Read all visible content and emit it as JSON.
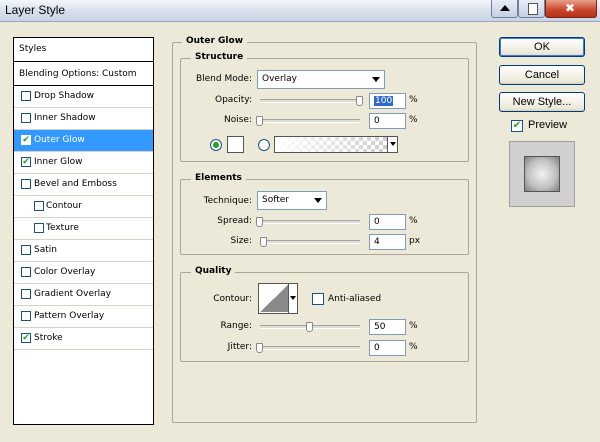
{
  "window": {
    "title": "Layer Style"
  },
  "sidebar": {
    "header": "Styles",
    "items": [
      {
        "label": "Blending Options: Custom",
        "checkbox": false,
        "checked": false,
        "selected": false,
        "indent": false
      },
      {
        "label": "Drop Shadow",
        "checkbox": true,
        "checked": false,
        "selected": false,
        "indent": false
      },
      {
        "label": "Inner Shadow",
        "checkbox": true,
        "checked": false,
        "selected": false,
        "indent": false
      },
      {
        "label": "Outer Glow",
        "checkbox": true,
        "checked": true,
        "selected": true,
        "indent": false
      },
      {
        "label": "Inner Glow",
        "checkbox": true,
        "checked": true,
        "selected": false,
        "indent": false
      },
      {
        "label": "Bevel and Emboss",
        "checkbox": true,
        "checked": false,
        "selected": false,
        "indent": false
      },
      {
        "label": "Contour",
        "checkbox": true,
        "checked": false,
        "selected": false,
        "indent": true
      },
      {
        "label": "Texture",
        "checkbox": true,
        "checked": false,
        "selected": false,
        "indent": true
      },
      {
        "label": "Satin",
        "checkbox": true,
        "checked": false,
        "selected": false,
        "indent": false
      },
      {
        "label": "Color Overlay",
        "checkbox": true,
        "checked": false,
        "selected": false,
        "indent": false
      },
      {
        "label": "Gradient Overlay",
        "checkbox": true,
        "checked": false,
        "selected": false,
        "indent": false
      },
      {
        "label": "Pattern Overlay",
        "checkbox": true,
        "checked": false,
        "selected": false,
        "indent": false
      },
      {
        "label": "Stroke",
        "checkbox": true,
        "checked": true,
        "selected": false,
        "indent": false
      }
    ]
  },
  "outer_glow": {
    "title": "Outer Glow",
    "structure": {
      "title": "Structure",
      "blend_mode_label": "Blend Mode:",
      "blend_mode_value": "Overlay",
      "opacity_label": "Opacity:",
      "opacity_value": "100",
      "opacity_level": 1.0,
      "noise_label": "Noise:",
      "noise_value": "0",
      "noise_level": 0.0,
      "unit_percent": "%",
      "color_mode_selected": "solid"
    },
    "elements": {
      "title": "Elements",
      "technique_label": "Technique:",
      "technique_value": "Softer",
      "spread_label": "Spread:",
      "spread_value": "0",
      "spread_level": 0.0,
      "size_label": "Size:",
      "size_value": "4",
      "size_level": 0.04,
      "unit_percent": "%",
      "unit_px": "px"
    },
    "quality": {
      "title": "Quality",
      "contour_label": "Contour:",
      "anti_aliased_label": "Anti-aliased",
      "anti_aliased": false,
      "range_label": "Range:",
      "range_value": "50",
      "range_level": 0.5,
      "jitter_label": "Jitter:",
      "jitter_value": "0",
      "jitter_level": 0.0,
      "unit_percent": "%"
    }
  },
  "actions": {
    "ok_label": "OK",
    "cancel_label": "Cancel",
    "new_style_label": "New Style...",
    "preview_label": "Preview",
    "preview_checked": true
  },
  "colors": {
    "selection": "#3399ff",
    "dialog_bg": "#ece9d8",
    "checkmark": "#21a121"
  }
}
